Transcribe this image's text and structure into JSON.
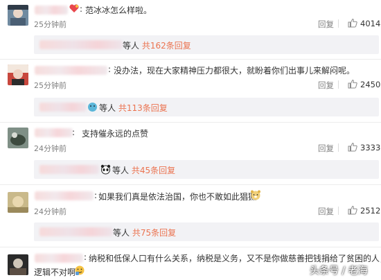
{
  "comments": [
    {
      "text": "范冰冰怎么样啦。",
      "time": "25分钟前",
      "reply_label": "回复",
      "likes": "4014",
      "replies": {
        "suffix": "等人",
        "link": "共162条回复"
      }
    },
    {
      "text": "没办法，现在大家精神压力都很大，就盼着你们出事儿来解闷呢。",
      "time": "25分钟前",
      "reply_label": "回复",
      "likes": "2450",
      "replies": {
        "suffix": "等人",
        "link": "共113条回复"
      }
    },
    {
      "text": "支持催永远的点赞",
      "time": "24分钟前",
      "reply_label": "回复",
      "likes": "3333",
      "replies": {
        "suffix": "等人",
        "link": "共45条回复"
      }
    },
    {
      "text": "如果我们真是依法治国，你也不敢如此猖獗",
      "time": "24分钟前",
      "reply_label": "回复",
      "likes": "2512",
      "replies": {
        "suffix": "等人",
        "link": "共75条回复"
      }
    },
    {
      "text_line1": "纳税和低保人口有什么关系，纳税是义务，又不是你做慈善把钱捐给了贫困的人，",
      "text_line2": "逻辑不对啊"
    }
  ],
  "watermark": "头条号 / 老海",
  "colors": {
    "link": "#eb7350",
    "meta": "#808080",
    "reply_bg": "#f2f2f5"
  },
  "icons": {
    "like": "thumbs-up-icon"
  }
}
